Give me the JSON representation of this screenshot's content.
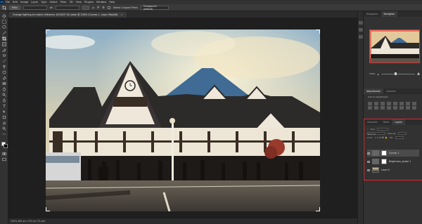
{
  "app": {
    "logo": "Ps"
  },
  "menu": [
    "File",
    "Edit",
    "Image",
    "Layer",
    "Type",
    "Select",
    "Filter",
    "3D",
    "View",
    "Plugins",
    "Window",
    "Help"
  ],
  "options": {
    "ratio_label": "Ratio",
    "delete_cropped_label": "Delete Cropped Pixels",
    "fill_value": "Transparent (default)"
  },
  "document": {
    "tab_title": "Change lighting to match reference #10425 %0 peak @ 100% (Curves 1, Layer Mask/8)",
    "close_glyph": "×"
  },
  "status": {
    "text": "100% 400 px x 372 px (72 ppi)"
  },
  "panels": {
    "top_tabs": [
      "Histogram",
      "Navigator"
    ],
    "zoom_value": "100%",
    "adjustments_tabs": [
      "Adjustments",
      "Libraries"
    ],
    "adjustments_hint": "Add an adjustment",
    "layer_tabs": [
      "Channels",
      "Paths",
      "Layers"
    ],
    "filter_label": "Kind",
    "blend_mode": "Normal",
    "opacity_label": "Opacity:",
    "lock_label": "Lock:",
    "fill_label": "Fill:",
    "layers": [
      {
        "name": "Curves 1",
        "type": "adjustment"
      },
      {
        "name": "Brightness_shade 1",
        "type": "adjustment"
      },
      {
        "name": "Layer 0",
        "type": "image"
      }
    ]
  },
  "colors": {
    "accent_highlight": "#e0262b",
    "app_bg": "#262626",
    "panel_bg": "#323232"
  }
}
